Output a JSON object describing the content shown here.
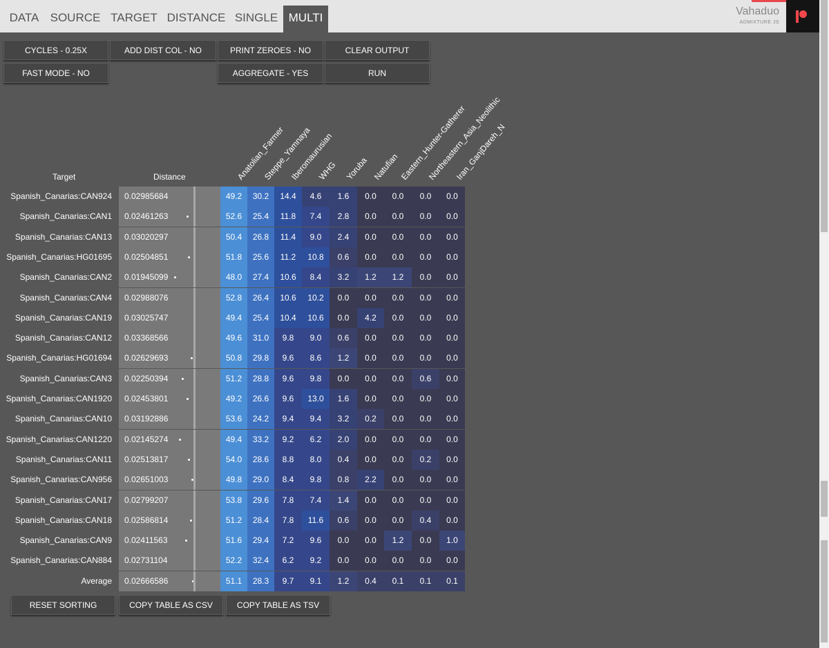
{
  "tabs": [
    "DATA",
    "SOURCE",
    "TARGET",
    "DISTANCE",
    "SINGLE",
    "MULTI"
  ],
  "active_tab": "MULTI",
  "brand": {
    "name": "Vahaduo",
    "sub": "ADMIXTURE JS"
  },
  "buttons": {
    "cycles": "CYCLES - 0.25X",
    "add_dist_col": "ADD DIST COL - NO",
    "print_zeroes": "PRINT ZEROES - NO",
    "clear_output": "CLEAR OUTPUT",
    "fast_mode": "FAST MODE - NO",
    "aggregate": "AGGREGATE - YES",
    "run": "RUN",
    "reset_sorting": "RESET SORTING",
    "copy_csv": "COPY TABLE AS CSV",
    "copy_tsv": "COPY TABLE AS TSV"
  },
  "table": {
    "target_header": "Target",
    "distance_header": "Distance",
    "columns": [
      "Anatolian_Farmer",
      "Steppe_Yamnaya",
      "Iberomaurusian",
      "WHG",
      "Yoruba",
      "Natufian",
      "Eastern_Hunter-Gatherer",
      "Northeastern_Asia_Neolithic",
      "Iran_GanjDareh_N"
    ],
    "rows": [
      {
        "target": "Spanish_Canarias:CAN924",
        "distance": "0.02985684",
        "values": [
          "49.2",
          "30.2",
          "14.4",
          "4.6",
          "1.6",
          "0.0",
          "0.0",
          "0.0",
          "0.0"
        ]
      },
      {
        "target": "Spanish_Canarias:CAN1",
        "distance": "0.02461263",
        "values": [
          "52.6",
          "25.4",
          "11.8",
          "7.4",
          "2.8",
          "0.0",
          "0.0",
          "0.0",
          "0.0"
        ]
      },
      {
        "target": "Spanish_Canarias:CAN13",
        "distance": "0.03020297",
        "values": [
          "50.4",
          "26.8",
          "11.4",
          "9.0",
          "2.4",
          "0.0",
          "0.0",
          "0.0",
          "0.0"
        ]
      },
      {
        "target": "Spanish_Canarias:HG01695",
        "distance": "0.02504851",
        "values": [
          "51.8",
          "25.6",
          "11.2",
          "10.8",
          "0.6",
          "0.0",
          "0.0",
          "0.0",
          "0.0"
        ]
      },
      {
        "target": "Spanish_Canarias:CAN2",
        "distance": "0.01945099",
        "values": [
          "48.0",
          "27.4",
          "10.6",
          "8.4",
          "3.2",
          "1.2",
          "1.2",
          "0.0",
          "0.0"
        ]
      },
      {
        "target": "Spanish_Canarias:CAN4",
        "distance": "0.02988076",
        "values": [
          "52.8",
          "26.4",
          "10.6",
          "10.2",
          "0.0",
          "0.0",
          "0.0",
          "0.0",
          "0.0"
        ]
      },
      {
        "target": "Spanish_Canarias:CAN19",
        "distance": "0.03025747",
        "values": [
          "49.4",
          "25.4",
          "10.4",
          "10.6",
          "0.0",
          "4.2",
          "0.0",
          "0.0",
          "0.0"
        ]
      },
      {
        "target": "Spanish_Canarias:CAN12",
        "distance": "0.03368566",
        "values": [
          "49.6",
          "31.0",
          "9.8",
          "9.0",
          "0.6",
          "0.0",
          "0.0",
          "0.0",
          "0.0"
        ]
      },
      {
        "target": "Spanish_Canarias:HG01694",
        "distance": "0.02629693",
        "values": [
          "50.8",
          "29.8",
          "9.6",
          "8.6",
          "1.2",
          "0.0",
          "0.0",
          "0.0",
          "0.0"
        ]
      },
      {
        "target": "Spanish_Canarias:CAN3",
        "distance": "0.02250394",
        "values": [
          "51.2",
          "28.8",
          "9.6",
          "9.8",
          "0.0",
          "0.0",
          "0.0",
          "0.6",
          "0.0"
        ]
      },
      {
        "target": "Spanish_Canarias:CAN1920",
        "distance": "0.02453801",
        "values": [
          "49.2",
          "26.6",
          "9.6",
          "13.0",
          "1.6",
          "0.0",
          "0.0",
          "0.0",
          "0.0"
        ]
      },
      {
        "target": "Spanish_Canarias:CAN10",
        "distance": "0.03192886",
        "values": [
          "53.6",
          "24.2",
          "9.4",
          "9.4",
          "3.2",
          "0.2",
          "0.0",
          "0.0",
          "0.0"
        ]
      },
      {
        "target": "Spanish_Canarias:CAN1220",
        "distance": "0.02145274",
        "values": [
          "49.4",
          "33.2",
          "9.2",
          "6.2",
          "2.0",
          "0.0",
          "0.0",
          "0.0",
          "0.0"
        ]
      },
      {
        "target": "Spanish_Canarias:CAN11",
        "distance": "0.02513817",
        "values": [
          "54.0",
          "28.6",
          "8.8",
          "8.0",
          "0.4",
          "0.0",
          "0.0",
          "0.2",
          "0.0"
        ]
      },
      {
        "target": "Spanish_Canarias:CAN956",
        "distance": "0.02651003",
        "values": [
          "49.8",
          "29.0",
          "8.4",
          "9.8",
          "0.8",
          "2.2",
          "0.0",
          "0.0",
          "0.0"
        ]
      },
      {
        "target": "Spanish_Canarias:CAN17",
        "distance": "0.02799207",
        "values": [
          "53.8",
          "29.6",
          "7.8",
          "7.4",
          "1.4",
          "0.0",
          "0.0",
          "0.0",
          "0.0"
        ]
      },
      {
        "target": "Spanish_Canarias:CAN18",
        "distance": "0.02586814",
        "values": [
          "51.2",
          "28.4",
          "7.8",
          "11.6",
          "0.6",
          "0.0",
          "0.0",
          "0.4",
          "0.0"
        ]
      },
      {
        "target": "Spanish_Canarias:CAN9",
        "distance": "0.02411563",
        "values": [
          "51.6",
          "29.4",
          "7.2",
          "9.6",
          "0.0",
          "0.0",
          "1.2",
          "0.0",
          "1.0"
        ]
      },
      {
        "target": "Spanish_Canarias:CAN884",
        "distance": "0.02731104",
        "values": [
          "52.2",
          "32.4",
          "6.2",
          "9.2",
          "0.0",
          "0.0",
          "0.0",
          "0.0",
          "0.0"
        ]
      },
      {
        "target": "Average",
        "distance": "0.02666586",
        "values": [
          "51.1",
          "28.3",
          "9.7",
          "9.1",
          "1.2",
          "0.4",
          "0.1",
          "0.1",
          "0.1"
        ]
      }
    ]
  }
}
